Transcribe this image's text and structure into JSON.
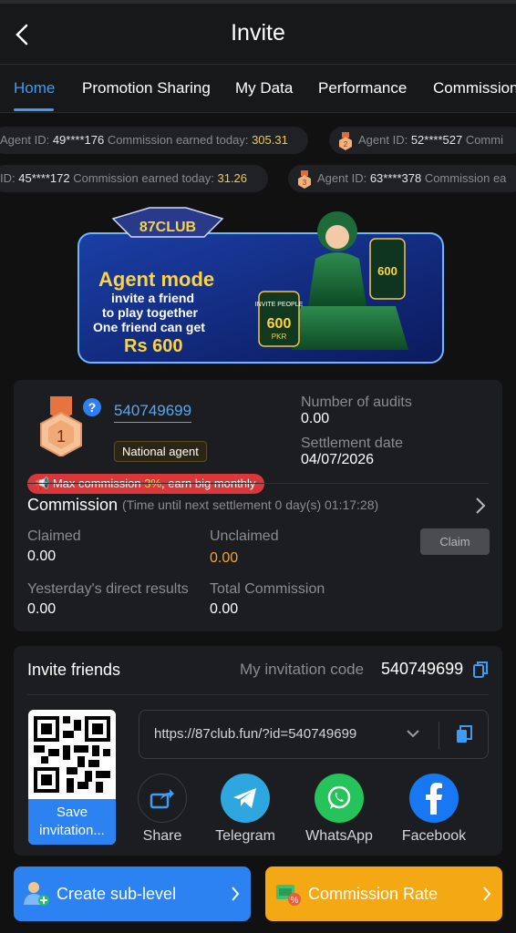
{
  "header": {
    "title": "Invite"
  },
  "tabs": [
    "Home",
    "Promotion Sharing",
    "My Data",
    "Performance",
    "Commission"
  ],
  "ticker": [
    {
      "prefix": "Agent ID: ",
      "id": "49****176",
      "text": " Commission earned today: ",
      "amount": "305.31"
    },
    {
      "prefix": "Agent ID: ",
      "id": "52****527",
      "text": " Commi",
      "amount": ""
    },
    {
      "prefix": "ID: ",
      "id": "45****172",
      "text": " Commission earned today: ",
      "amount": "31.26"
    },
    {
      "prefix": "Agent ID: ",
      "id": "63****378",
      "text": " Commission ea",
      "amount": ""
    }
  ],
  "banner": {
    "logo": "87CLUB",
    "headline": "Agent mode",
    "line1": "invite a friend",
    "line2": "to play together",
    "line3": "One friend can get",
    "amount": "Rs 600",
    "card_text": "INVITE PEOPLE",
    "card_amount": "600",
    "card_currency": "PKR"
  },
  "agent": {
    "rank": "1",
    "id": "540749699",
    "level": "National agent",
    "audits_label": "Number of audits",
    "audits_value": "0.00",
    "settlement_label": "Settlement date",
    "settlement_value": "04/07/2026",
    "promo_pre": "Max commission ",
    "promo_hl": "3%",
    "promo_post": ", earn big monthly",
    "commission_title": "Commission",
    "commission_sub": "(Time until next settlement  0 day(s) 01:17:28)",
    "claimed_label": "Claimed",
    "claimed_value": "0.00",
    "unclaimed_label": "Unclaimed",
    "unclaimed_value": "0.00",
    "claim_button": "Claim",
    "yesterday_label": "Yesterday's direct results",
    "yesterday_value": "0.00",
    "total_label": "Total Commission",
    "total_value": "0.00"
  },
  "invite": {
    "title": "Invite friends",
    "code_label": "My invitation code",
    "code": "540749699",
    "save_label": "Save invitation...",
    "link": "https://87club.fun/?id=540749699",
    "share": [
      "Share",
      "Telegram",
      "WhatsApp",
      "Facebook"
    ]
  },
  "bottom": {
    "create": "Create sub-level",
    "rate": "Commission Rate"
  },
  "colors": {
    "accent": "#3d9cf5",
    "gold": "#f2a531",
    "create_btn": "#2b82f0",
    "rate_btn": "#f3a814"
  }
}
